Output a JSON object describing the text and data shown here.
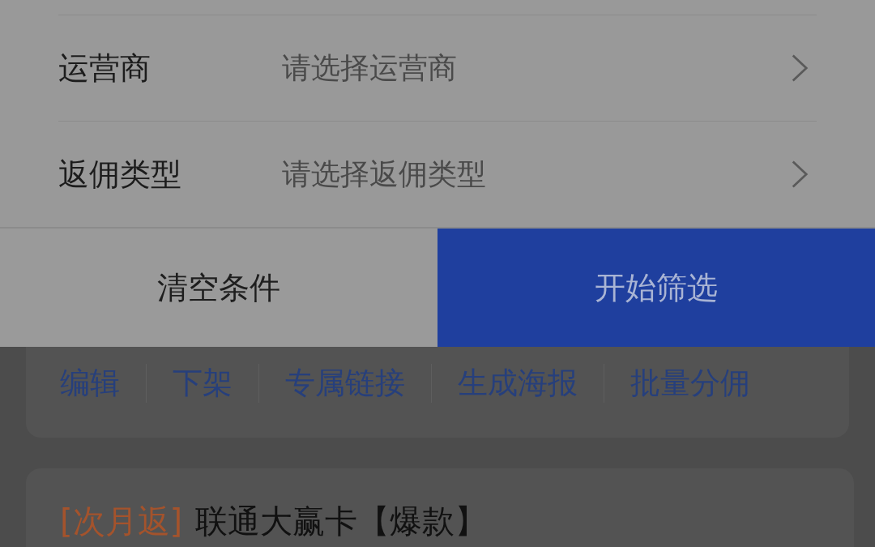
{
  "filter_rows": [
    {
      "label": "运营商",
      "placeholder": "请选择运营商"
    },
    {
      "label": "返佣类型",
      "placeholder": "请选择返佣类型"
    }
  ],
  "buttons": [
    {
      "label": "清空条件",
      "kind": "secondary"
    },
    {
      "label": "开始筛选",
      "kind": "primary"
    }
  ],
  "product_card": {
    "actions": [
      "编辑",
      "下架",
      "专属链接",
      "生成海报",
      "批量分佣"
    ]
  },
  "next_product": {
    "tag": "[次月返]",
    "title": "联通大赢卡【爆款】"
  }
}
